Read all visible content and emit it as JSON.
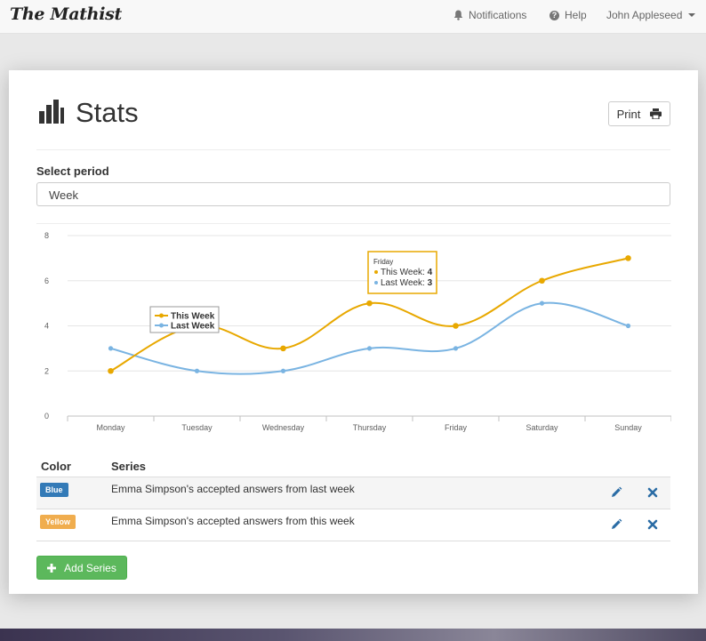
{
  "app": {
    "brand": "The Mathist",
    "nav": {
      "notifications": "Notifications",
      "help": "Help",
      "user": "John Appleseed"
    }
  },
  "page": {
    "title": "Stats",
    "print_label": "Print",
    "period_label": "Select period",
    "period_value": "Week"
  },
  "chart_data": {
    "type": "line",
    "categories": [
      "Monday",
      "Tuesday",
      "Wednesday",
      "Thursday",
      "Friday",
      "Saturday",
      "Sunday"
    ],
    "series": [
      {
        "name": "This Week",
        "values": [
          2,
          4,
          3,
          5,
          4,
          6,
          7
        ],
        "color": "#e8a800"
      },
      {
        "name": "Last Week",
        "values": [
          3,
          2,
          2,
          3,
          3,
          5,
          4
        ],
        "color": "#7ab4e2"
      }
    ],
    "ylim": [
      0,
      8
    ],
    "yticks": [
      0,
      2,
      4,
      6,
      8
    ],
    "grid": true,
    "legend": {
      "placement": "top-left",
      "entries": [
        "This Week",
        "Last Week"
      ]
    },
    "tooltip": {
      "category": "Friday",
      "lines": [
        {
          "name": "This Week",
          "value": "4"
        },
        {
          "name": "Last Week",
          "value": "3"
        }
      ]
    }
  },
  "table": {
    "headers": {
      "color": "Color",
      "series": "Series"
    },
    "rows": [
      {
        "badge": "Blue",
        "badge_color": "#337ab7",
        "series": "Emma Simpson's accepted answers from last week"
      },
      {
        "badge": "Yellow",
        "badge_color": "#f0ad4e",
        "series": "Emma Simpson's accepted answers from this week"
      }
    ]
  },
  "add_series_label": "Add Series",
  "colors": {
    "accent_blue": "#337ab7",
    "success": "#5cb85c",
    "this_week": "#e8a800",
    "last_week": "#7ab4e2"
  }
}
